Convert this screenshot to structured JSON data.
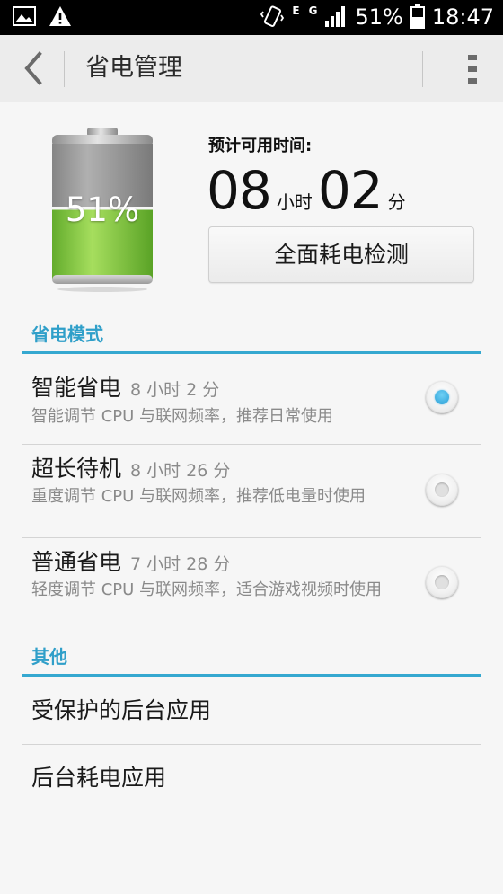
{
  "status_bar": {
    "battery_text": "51%",
    "time": "18:47",
    "network_e": "E",
    "network_g": "G",
    "icons": [
      "image-icon",
      "warning-icon",
      "vibrate-icon",
      "signal-icon",
      "battery-icon"
    ]
  },
  "action_bar": {
    "title": "省电管理",
    "back_icon": "back-arrow-icon",
    "overflow_icon": "overflow-menu-icon"
  },
  "battery": {
    "percent_text": "51%",
    "level": 0.51,
    "time_label": "预计可用时间:",
    "hours": "08",
    "hours_unit": "小时",
    "minutes": "02",
    "minutes_unit": "分",
    "check_button": "全面耗电检测"
  },
  "modes_section": {
    "header": "省电模式",
    "items": [
      {
        "name": "智能省电",
        "time": "8 小时 2 分",
        "desc": "智能调节 CPU 与联网频率，推荐日常使用",
        "selected": true
      },
      {
        "name": "超长待机",
        "time": "8 小时 26 分",
        "desc": "重度调节 CPU 与联网频率，推荐低电量时使用",
        "selected": false
      },
      {
        "name": "普通省电",
        "time": "7 小时 28 分",
        "desc": "轻度调节 CPU 与联网频率，适合游戏视频时使用",
        "selected": false
      }
    ]
  },
  "other_section": {
    "header": "其他",
    "items": [
      "受保护的后台应用",
      "后台耗电应用"
    ]
  },
  "colors": {
    "accent": "#35a8d0",
    "battery_green": "#7cc63a",
    "radio_selected": "#2a9fd6"
  }
}
